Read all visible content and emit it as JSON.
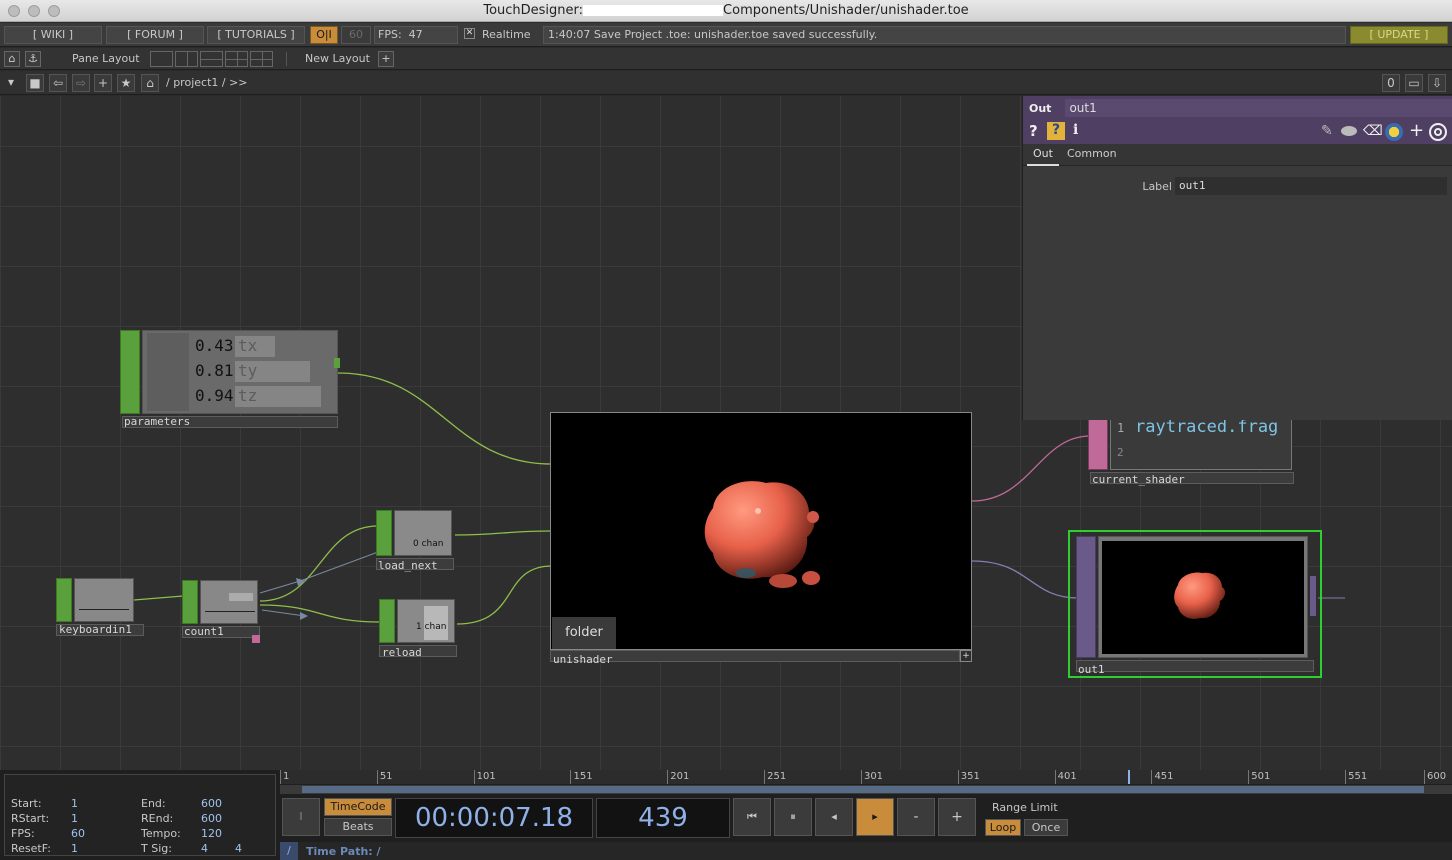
{
  "window": {
    "title_prefix": "TouchDesigner:",
    "title_suffix": "Components/Unishader/unishader.toe"
  },
  "menubar": {
    "wiki": "[ WIKI ]",
    "forum": "[ FORUM ]",
    "tutorials": "[ TUTORIALS ]",
    "oi": "O|I",
    "fps_cap": "60",
    "fps_label": "FPS:",
    "fps_value": "47",
    "realtime_check": "✕",
    "realtime_label": "Realtime",
    "status": "1:40:07 Save Project .toe: unishader.toe saved successfully.",
    "update": "[ UPDATE ]"
  },
  "panebar": {
    "pane_layout": "Pane Layout",
    "new_layout": "New Layout",
    "add": "+"
  },
  "pathbar": {
    "path": "/ project1 / >>",
    "counter": "0"
  },
  "nodes": {
    "parameters": {
      "label": "parameters",
      "channels": [
        {
          "value": "0.43",
          "name": "tx",
          "level": 0.43
        },
        {
          "value": "0.81",
          "name": "ty",
          "level": 0.81
        },
        {
          "value": "0.94",
          "name": "tz",
          "level": 0.94
        }
      ]
    },
    "keyboardin1": {
      "label": "keyboardin1"
    },
    "count1": {
      "label": "count1"
    },
    "load_next": {
      "label": "load_next",
      "info": "0 chan"
    },
    "reload": {
      "label": "reload",
      "info": "1 chan"
    },
    "unishader": {
      "label": "unishader",
      "folder": "folder"
    },
    "current_shader": {
      "label": "current_shader",
      "lines": [
        {
          "num": "1",
          "text": "raytraced.frag"
        },
        {
          "num": "2",
          "text": ""
        }
      ]
    },
    "out1": {
      "label": "out1"
    }
  },
  "params_panel": {
    "type": "Out",
    "name": "out1",
    "help": "?",
    "python_help": "?",
    "info": "i",
    "tabs": [
      "Out",
      "Common"
    ],
    "label_caption": "Label",
    "label_value": "out1"
  },
  "timeline": {
    "ticks": [
      "1",
      "51",
      "101",
      "151",
      "201",
      "251",
      "301",
      "351",
      "401",
      "451",
      "501",
      "551",
      "600"
    ],
    "start_label": "Start:",
    "start": "1",
    "end_label": "End:",
    "end": "600",
    "rstart_label": "RStart:",
    "rstart": "1",
    "rend_label": "REnd:",
    "rend": "600",
    "fps_label": "FPS:",
    "fps": "60",
    "tempo_label": "Tempo:",
    "tempo": "120",
    "resetf_label": "ResetF:",
    "resetf": "1",
    "tsig_label": "T Sig:",
    "tsig_a": "4",
    "tsig_b": "4",
    "i_button": "I",
    "timecode": "TimeCode",
    "beats": "Beats",
    "clock": "00:00:07.18",
    "frame": "439",
    "minus": "-",
    "plus": "+",
    "range_limit": "Range Limit",
    "loop": "Loop",
    "once": "Once",
    "root": "/",
    "time_path": "Time Path: /",
    "playhead_frame": 439
  },
  "colors": {
    "chop_green": "#5aa03c",
    "dat_pink": "#c06a9a",
    "top_purple": "#6a5a8a",
    "accent_orange": "#c98c3a",
    "selected_green": "#2fcf2f"
  }
}
